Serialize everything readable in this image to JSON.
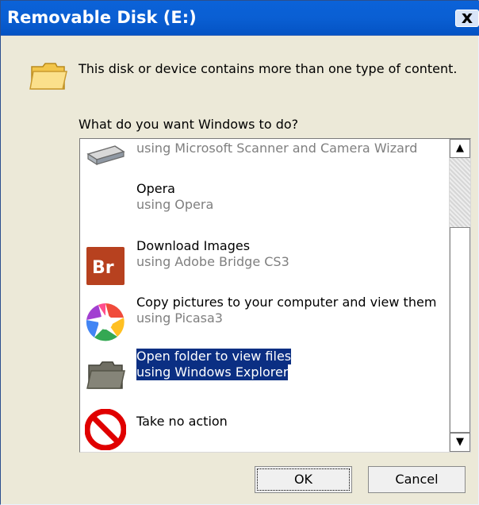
{
  "window": {
    "title": "Removable Disk (E:)",
    "close_label": "x"
  },
  "dialog": {
    "description": "This disk or device contains more than one type of content.",
    "question": "What do you want Windows to do?"
  },
  "icons": {
    "header": "folder-icon",
    "scanner": "scanner-icon",
    "opera": "opera-icon",
    "bridge": "adobe-bridge-icon",
    "picasa": "picasa-icon",
    "explorer": "folder-icon",
    "noaction": "no-action-icon"
  },
  "list": {
    "items": [
      {
        "id": "scanner",
        "label": "",
        "sublabel": "using Microsoft Scanner and Camera Wizard"
      },
      {
        "id": "opera",
        "label": "Opera",
        "sublabel": "using Opera"
      },
      {
        "id": "bridge",
        "label": "Download Images",
        "sublabel": "using Adobe Bridge CS3"
      },
      {
        "id": "picasa",
        "label": "Copy pictures to your computer and view them",
        "sublabel": "using Picasa3"
      },
      {
        "id": "explorer",
        "label": "Open folder to view files",
        "sublabel": "using Windows Explorer",
        "selected": true
      },
      {
        "id": "noaction",
        "label": "Take no action",
        "sublabel": ""
      }
    ]
  },
  "buttons": {
    "ok": "OK",
    "cancel": "Cancel"
  },
  "colors": {
    "titlebar": "#0a5fd3",
    "selection": "#0b2f83",
    "dialog_bg": "#ece9d8"
  }
}
